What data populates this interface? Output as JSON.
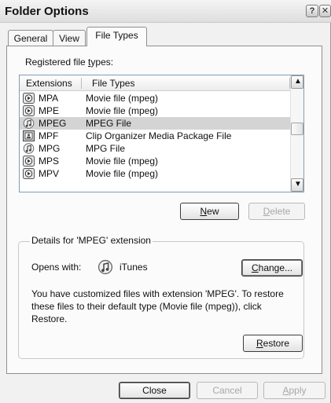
{
  "window": {
    "title": "Folder Options",
    "help_glyph": "?",
    "close_glyph": "✕"
  },
  "tabs": [
    {
      "label": "General"
    },
    {
      "label": "View"
    },
    {
      "label": "File Types"
    }
  ],
  "registered": {
    "label_pre": "Registered file ",
    "label_ul": "t",
    "label_post": "ypes:"
  },
  "list": {
    "col_extensions": "Extensions",
    "col_filetypes": "File Types",
    "rows": [
      {
        "ext": "MPA",
        "type": "Movie file (mpeg)",
        "icon": "media-player-icon"
      },
      {
        "ext": "MPE",
        "type": "Movie file (mpeg)",
        "icon": "media-player-icon"
      },
      {
        "ext": "MPEG",
        "type": "MPEG File",
        "icon": "itunes-icon"
      },
      {
        "ext": "MPF",
        "type": "Clip Organizer Media Package File",
        "icon": "clip-organizer-icon"
      },
      {
        "ext": "MPG",
        "type": "MPG File",
        "icon": "itunes-icon"
      },
      {
        "ext": "MPS",
        "type": "Movie file (mpeg)",
        "icon": "media-player-icon"
      },
      {
        "ext": "MPV",
        "type": "Movie file (mpeg)",
        "icon": "media-player-icon"
      }
    ],
    "selected_ext": "MPEG",
    "scroll_up": "▲",
    "scroll_down": "▼"
  },
  "buttons": {
    "new_ul": "N",
    "new_rest": "ew",
    "delete_ul": "D",
    "delete_rest": "elete",
    "change_ul": "C",
    "change_rest": "hange...",
    "restore_ul": "R",
    "restore_rest": "estore",
    "close": "Close",
    "cancel": "Cancel",
    "apply_ul": "A",
    "apply_rest": "pply"
  },
  "details": {
    "legend": "Details for 'MPEG' extension",
    "opens_with_label": "Opens with:",
    "opens_with_app": "iTunes",
    "description": "You have customized files with extension 'MPEG'.  To restore these files to their default type (Movie file (mpeg)), click Restore."
  },
  "colors": {
    "selected_row": "#d4d4d4",
    "list_border": "#7f9db9",
    "disabled_text": "#a8a8a8"
  }
}
